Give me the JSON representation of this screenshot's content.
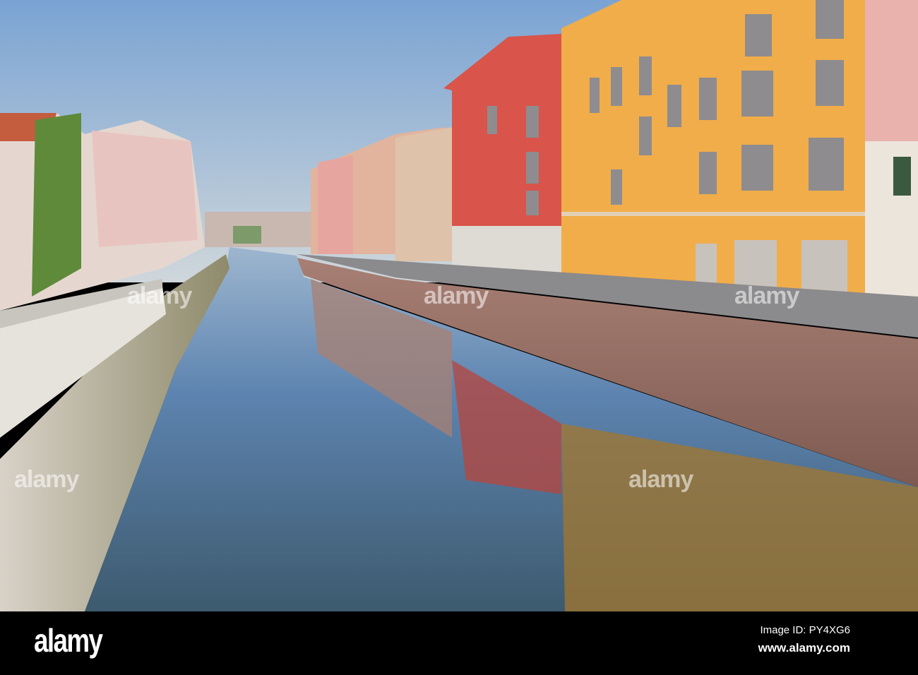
{
  "photo": {
    "subject": "Naviglio canal with reflections",
    "watermark": "alamy"
  },
  "footer": {
    "logo": "alamy",
    "image_id": "Image ID: PY4XG6",
    "website": "www.alamy.com"
  },
  "colors": {
    "sky_top": "#7fa6d4",
    "sky_bottom": "#cdd6dc",
    "red_building": "#d9544a",
    "yellow_building": "#f0ad4a",
    "water": "#5a7fa6",
    "footer_bg": "#000000"
  }
}
